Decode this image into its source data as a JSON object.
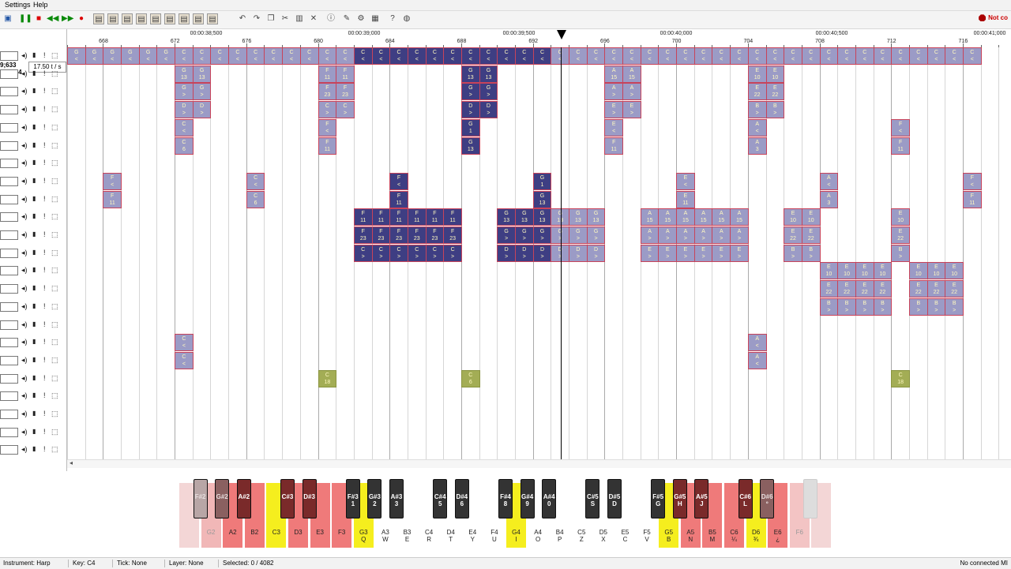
{
  "menu": [
    "Settings",
    "Help"
  ],
  "toolbar": {
    "buttons": [
      "save-icon",
      "pause-icon",
      "stop-icon",
      "rewind-icon",
      "fast-forward-icon",
      "record-icon",
      "layer-tool-icon",
      "layer-tool-icon",
      "layer-tool-icon",
      "layer-tool-icon",
      "layer-tool-icon",
      "layer-tool-icon",
      "layer-tool-icon",
      "layer-tool-icon",
      "layer-tool-icon",
      "undo-icon",
      "redo-icon",
      "copy-icon",
      "cut-icon",
      "paste-icon",
      "delete-icon",
      "info-icon",
      "edit-icon",
      "settings-icon",
      "piano-icon",
      "help-icon",
      "about-icon"
    ],
    "status": "Not co"
  },
  "position": {
    "line1": "9;633",
    "line2": "-27;314"
  },
  "tps": "17.50 t / s",
  "timeline": {
    "times": [
      "00:00:38;500",
      "00:00:39;000",
      "00:00:39;500",
      "00:00:40;000",
      "00:00:40;500",
      "00:00:41;000"
    ],
    "beats": [
      "668",
      "672",
      "676",
      "680",
      "684",
      "688",
      "692",
      "696",
      "700",
      "704",
      "708",
      "712",
      "716"
    ]
  },
  "tracks_count": 23,
  "notes": [
    {
      "lane": 0,
      "start": 0,
      "end": 27,
      "dark": false,
      "top": "G",
      "bot": "<"
    },
    {
      "lane": 0,
      "start": 6,
      "end": 27,
      "dark": false,
      "top": "C",
      "bot": "<"
    },
    {
      "lane": 0,
      "start": 16,
      "end": 27,
      "dark": true,
      "top": "C",
      "bot": "<"
    },
    {
      "lane": 0,
      "start": 27,
      "end": 51,
      "dark": false,
      "top": "C",
      "bot": "<"
    },
    {
      "lane": 1,
      "start": 6,
      "end": 8,
      "dark": false,
      "top": "G",
      "bot": "13"
    },
    {
      "lane": 1,
      "start": 14,
      "end": 16,
      "dark": false,
      "top": "F",
      "bot": "11"
    },
    {
      "lane": 1,
      "start": 22,
      "end": 24,
      "dark": true,
      "top": "G",
      "bot": "13"
    },
    {
      "lane": 1,
      "start": 30,
      "end": 32,
      "dark": false,
      "top": "A",
      "bot": "15"
    },
    {
      "lane": 1,
      "start": 38,
      "end": 40,
      "dark": false,
      "top": "E",
      "bot": "10"
    },
    {
      "lane": 2,
      "start": 6,
      "end": 8,
      "dark": false,
      "top": "G",
      "bot": ">"
    },
    {
      "lane": 2,
      "start": 14,
      "end": 16,
      "dark": false,
      "top": "F",
      "bot": "23"
    },
    {
      "lane": 2,
      "start": 22,
      "end": 24,
      "dark": true,
      "top": "G",
      "bot": ">"
    },
    {
      "lane": 2,
      "start": 30,
      "end": 32,
      "dark": false,
      "top": "A",
      "bot": ">"
    },
    {
      "lane": 2,
      "start": 38,
      "end": 40,
      "dark": false,
      "top": "E",
      "bot": "22"
    },
    {
      "lane": 3,
      "start": 6,
      "end": 8,
      "dark": false,
      "top": "D",
      "bot": ">"
    },
    {
      "lane": 3,
      "start": 14,
      "end": 16,
      "dark": false,
      "top": "C",
      "bot": ">"
    },
    {
      "lane": 3,
      "start": 22,
      "end": 24,
      "dark": true,
      "top": "D",
      "bot": ">"
    },
    {
      "lane": 3,
      "start": 30,
      "end": 32,
      "dark": false,
      "top": "E",
      "bot": ">"
    },
    {
      "lane": 3,
      "start": 38,
      "end": 40,
      "dark": false,
      "top": "B",
      "bot": ">"
    },
    {
      "lane": 4,
      "start": 6,
      "end": 7,
      "dark": false,
      "top": "C",
      "bot": "<"
    },
    {
      "lane": 4,
      "start": 14,
      "end": 15,
      "dark": false,
      "top": "F",
      "bot": "<"
    },
    {
      "lane": 4,
      "start": 22,
      "end": 23,
      "dark": true,
      "top": "G",
      "bot": "1"
    },
    {
      "lane": 4,
      "start": 30,
      "end": 31,
      "dark": false,
      "top": "E",
      "bot": "<"
    },
    {
      "lane": 4,
      "start": 38,
      "end": 39,
      "dark": false,
      "top": "A",
      "bot": "<"
    },
    {
      "lane": 4,
      "start": 46,
      "end": 47,
      "dark": false,
      "top": "F",
      "bot": "<"
    },
    {
      "lane": 5,
      "start": 6,
      "end": 7,
      "dark": false,
      "top": "C",
      "bot": "6"
    },
    {
      "lane": 5,
      "start": 14,
      "end": 15,
      "dark": false,
      "top": "F",
      "bot": "11"
    },
    {
      "lane": 5,
      "start": 22,
      "end": 23,
      "dark": true,
      "top": "G",
      "bot": "13"
    },
    {
      "lane": 5,
      "start": 30,
      "end": 31,
      "dark": false,
      "top": "F",
      "bot": "11"
    },
    {
      "lane": 5,
      "start": 38,
      "end": 39,
      "dark": false,
      "top": "A",
      "bot": "3"
    },
    {
      "lane": 5,
      "start": 46,
      "end": 47,
      "dark": false,
      "top": "F",
      "bot": "11"
    },
    {
      "lane": 7,
      "start": 2,
      "end": 3,
      "dark": false,
      "top": "F",
      "bot": "<"
    },
    {
      "lane": 7,
      "start": 10,
      "end": 11,
      "dark": false,
      "top": "C",
      "bot": "<"
    },
    {
      "lane": 7,
      "start": 18,
      "end": 19,
      "dark": true,
      "top": "F",
      "bot": "<"
    },
    {
      "lane": 7,
      "start": 26,
      "end": 27,
      "dark": true,
      "top": "G",
      "bot": "1"
    },
    {
      "lane": 7,
      "start": 34,
      "end": 35,
      "dark": false,
      "top": "E",
      "bot": "<"
    },
    {
      "lane": 7,
      "start": 42,
      "end": 43,
      "dark": false,
      "top": "A",
      "bot": "<"
    },
    {
      "lane": 7,
      "start": 50,
      "end": 51,
      "dark": false,
      "top": "F",
      "bot": "<"
    },
    {
      "lane": 8,
      "start": 2,
      "end": 3,
      "dark": false,
      "top": "F",
      "bot": "11"
    },
    {
      "lane": 8,
      "start": 10,
      "end": 11,
      "dark": false,
      "top": "C",
      "bot": "6"
    },
    {
      "lane": 8,
      "start": 18,
      "end": 19,
      "dark": true,
      "top": "F",
      "bot": "11"
    },
    {
      "lane": 8,
      "start": 26,
      "end": 27,
      "dark": true,
      "top": "G",
      "bot": "13"
    },
    {
      "lane": 8,
      "start": 34,
      "end": 35,
      "dark": false,
      "top": "E",
      "bot": "11"
    },
    {
      "lane": 8,
      "start": 42,
      "end": 43,
      "dark": false,
      "top": "A",
      "bot": "3"
    },
    {
      "lane": 8,
      "start": 50,
      "end": 51,
      "dark": false,
      "top": "F",
      "bot": "11"
    },
    {
      "lane": 9,
      "start": 16,
      "end": 22,
      "dark": true,
      "top": "F",
      "bot": "11"
    },
    {
      "lane": 9,
      "start": 24,
      "end": 27,
      "dark": true,
      "top": "G",
      "bot": "13"
    },
    {
      "lane": 9,
      "start": 27,
      "end": 30,
      "dark": false,
      "top": "G",
      "bot": "13"
    },
    {
      "lane": 9,
      "start": 32,
      "end": 38,
      "dark": false,
      "top": "A",
      "bot": "15"
    },
    {
      "lane": 9,
      "start": 40,
      "end": 42,
      "dark": false,
      "top": "E",
      "bot": "10"
    },
    {
      "lane": 9,
      "start": 46,
      "end": 47,
      "dark": false,
      "top": "E",
      "bot": "10"
    },
    {
      "lane": 10,
      "start": 16,
      "end": 22,
      "dark": true,
      "top": "F",
      "bot": "23"
    },
    {
      "lane": 10,
      "start": 24,
      "end": 27,
      "dark": true,
      "top": "G",
      "bot": ">"
    },
    {
      "lane": 10,
      "start": 27,
      "end": 30,
      "dark": false,
      "top": "G",
      "bot": ">"
    },
    {
      "lane": 10,
      "start": 32,
      "end": 38,
      "dark": false,
      "top": "A",
      "bot": ">"
    },
    {
      "lane": 10,
      "start": 40,
      "end": 42,
      "dark": false,
      "top": "E",
      "bot": "22"
    },
    {
      "lane": 10,
      "start": 46,
      "end": 47,
      "dark": false,
      "top": "E",
      "bot": "22"
    },
    {
      "lane": 11,
      "start": 16,
      "end": 22,
      "dark": true,
      "top": "C",
      "bot": ">"
    },
    {
      "lane": 11,
      "start": 24,
      "end": 27,
      "dark": true,
      "top": "D",
      "bot": ">"
    },
    {
      "lane": 11,
      "start": 27,
      "end": 30,
      "dark": false,
      "top": "D",
      "bot": ">"
    },
    {
      "lane": 11,
      "start": 32,
      "end": 38,
      "dark": false,
      "top": "E",
      "bot": ">"
    },
    {
      "lane": 11,
      "start": 40,
      "end": 42,
      "dark": false,
      "top": "B",
      "bot": ">"
    },
    {
      "lane": 11,
      "start": 46,
      "end": 47,
      "dark": false,
      "top": "B",
      "bot": ">"
    },
    {
      "lane": 12,
      "start": 42,
      "end": 46,
      "dark": false,
      "top": "E",
      "bot": "10"
    },
    {
      "lane": 12,
      "start": 47,
      "end": 50,
      "dark": false,
      "top": "E",
      "bot": "10"
    },
    {
      "lane": 13,
      "start": 42,
      "end": 46,
      "dark": false,
      "top": "E",
      "bot": "22"
    },
    {
      "lane": 13,
      "start": 47,
      "end": 50,
      "dark": false,
      "top": "E",
      "bot": "22"
    },
    {
      "lane": 14,
      "start": 42,
      "end": 46,
      "dark": false,
      "top": "B",
      "bot": ">"
    },
    {
      "lane": 14,
      "start": 47,
      "end": 50,
      "dark": false,
      "top": "B",
      "bot": ">"
    },
    {
      "lane": 16,
      "start": 6,
      "end": 7,
      "dark": false,
      "top": "C",
      "bot": "<"
    },
    {
      "lane": 16,
      "start": 38,
      "end": 39,
      "dark": false,
      "top": "A",
      "bot": "<"
    },
    {
      "lane": 17,
      "start": 6,
      "end": 7,
      "dark": false,
      "top": "C",
      "bot": "<"
    },
    {
      "lane": 17,
      "start": 38,
      "end": 39,
      "dark": false,
      "top": "A",
      "bot": "<"
    },
    {
      "lane": 18,
      "start": 14,
      "end": 15,
      "green": true,
      "top": "C",
      "bot": "18"
    },
    {
      "lane": 18,
      "start": 22,
      "end": 23,
      "green": true,
      "top": "C",
      "bot": "6"
    },
    {
      "lane": 18,
      "start": 46,
      "end": 47,
      "green": true,
      "top": "C",
      "bot": "18"
    }
  ],
  "piano": {
    "white": [
      {
        "note": "",
        "key": "",
        "color": "#f3d6d6"
      },
      {
        "note": "G2",
        "key": "",
        "color": "#f1b7b7"
      },
      {
        "note": "A2",
        "key": "",
        "color": "#ef7a7a"
      },
      {
        "note": "B2",
        "key": "",
        "color": "#ef7a7a"
      },
      {
        "note": "C3",
        "key": "",
        "color": "#f5ee1e"
      },
      {
        "note": "D3",
        "key": "",
        "color": "#ef7a7a"
      },
      {
        "note": "E3",
        "key": "",
        "color": "#ef7a7a"
      },
      {
        "note": "F3",
        "key": "",
        "color": "#ef7a7a"
      },
      {
        "note": "G3",
        "key": "Q",
        "color": "#f5ee1e"
      },
      {
        "note": "A3",
        "key": "W",
        "color": "#ffffff"
      },
      {
        "note": "B3",
        "key": "E",
        "color": "#ffffff"
      },
      {
        "note": "C4",
        "key": "R",
        "color": "#ffffff"
      },
      {
        "note": "D4",
        "key": "T",
        "color": "#ffffff"
      },
      {
        "note": "E4",
        "key": "Y",
        "color": "#ffffff"
      },
      {
        "note": "F4",
        "key": "U",
        "color": "#ffffff"
      },
      {
        "note": "G4",
        "key": "I",
        "color": "#f5ee1e"
      },
      {
        "note": "A4",
        "key": "O",
        "color": "#ffffff"
      },
      {
        "note": "B4",
        "key": "P",
        "color": "#ffffff"
      },
      {
        "note": "C5",
        "key": "Z",
        "color": "#ffffff"
      },
      {
        "note": "D5",
        "key": "X",
        "color": "#ffffff"
      },
      {
        "note": "E5",
        "key": "C",
        "color": "#ffffff"
      },
      {
        "note": "F5",
        "key": "V",
        "color": "#ffffff"
      },
      {
        "note": "G5",
        "key": "B",
        "color": "#f5ee1e"
      },
      {
        "note": "A5",
        "key": "N",
        "color": "#ef7a7a"
      },
      {
        "note": "B5",
        "key": "M",
        "color": "#ef7a7a"
      },
      {
        "note": "C6",
        "key": "¼",
        "color": "#ef7a7a"
      },
      {
        "note": "D6",
        "key": "¾",
        "color": "#f5ee1e"
      },
      {
        "note": "E6",
        "key": "¿",
        "color": "#ef7a7a"
      },
      {
        "note": "F6",
        "key": "",
        "color": "#f3c4c4"
      },
      {
        "note": "",
        "key": "",
        "color": "#f3d6d6"
      }
    ],
    "black": [
      {
        "after": 0,
        "note": "F#2",
        "key": "",
        "color": "#b8a6a6"
      },
      {
        "after": 1,
        "note": "G#2",
        "key": "",
        "color": "#8a6060"
      },
      {
        "after": 2,
        "note": "A#2",
        "key": "",
        "color": "#7a2a2a"
      },
      {
        "after": 4,
        "note": "C#3",
        "key": "",
        "color": "#7a2a2a"
      },
      {
        "after": 5,
        "note": "D#3",
        "key": "",
        "color": "#7a2a2a"
      },
      {
        "after": 7,
        "note": "F#3",
        "key": "1",
        "color": "#333333"
      },
      {
        "after": 8,
        "note": "G#3",
        "key": "2",
        "color": "#333333"
      },
      {
        "after": 9,
        "note": "A#3",
        "key": "3",
        "color": "#333333"
      },
      {
        "after": 11,
        "note": "C#4",
        "key": "5",
        "color": "#333333"
      },
      {
        "after": 12,
        "note": "D#4",
        "key": "6",
        "color": "#333333"
      },
      {
        "after": 14,
        "note": "F#4",
        "key": "8",
        "color": "#333333"
      },
      {
        "after": 15,
        "note": "G#4",
        "key": "9",
        "color": "#333333"
      },
      {
        "after": 16,
        "note": "A#4",
        "key": "0",
        "color": "#333333"
      },
      {
        "after": 18,
        "note": "C#5",
        "key": "S",
        "color": "#333333"
      },
      {
        "after": 19,
        "note": "D#5",
        "key": "D",
        "color": "#333333"
      },
      {
        "after": 21,
        "note": "F#5",
        "key": "G",
        "color": "#333333"
      },
      {
        "after": 22,
        "note": "G#5",
        "key": "H",
        "color": "#7a2a2a"
      },
      {
        "after": 23,
        "note": "A#5",
        "key": "J",
        "color": "#7a2a2a"
      },
      {
        "after": 25,
        "note": "C#6",
        "key": "L",
        "color": "#7a2a2a"
      },
      {
        "after": 26,
        "note": "D#6",
        "key": "º",
        "color": "#8a6060"
      },
      {
        "after": 28,
        "note": "",
        "key": "",
        "color": "#dddddd"
      }
    ]
  },
  "statusbar": {
    "instrument": "Instrument: Harp",
    "key": "Key: C4",
    "tick": "Tick: None",
    "layer": "Layer: None",
    "selected": "Selected: 0 / 4082",
    "midi": "No connected MI"
  },
  "colors": {
    "note": "#9b9bc6",
    "note_dark": "#3e3e83",
    "note_border": "#c8435a",
    "green": "#a3ad55"
  }
}
